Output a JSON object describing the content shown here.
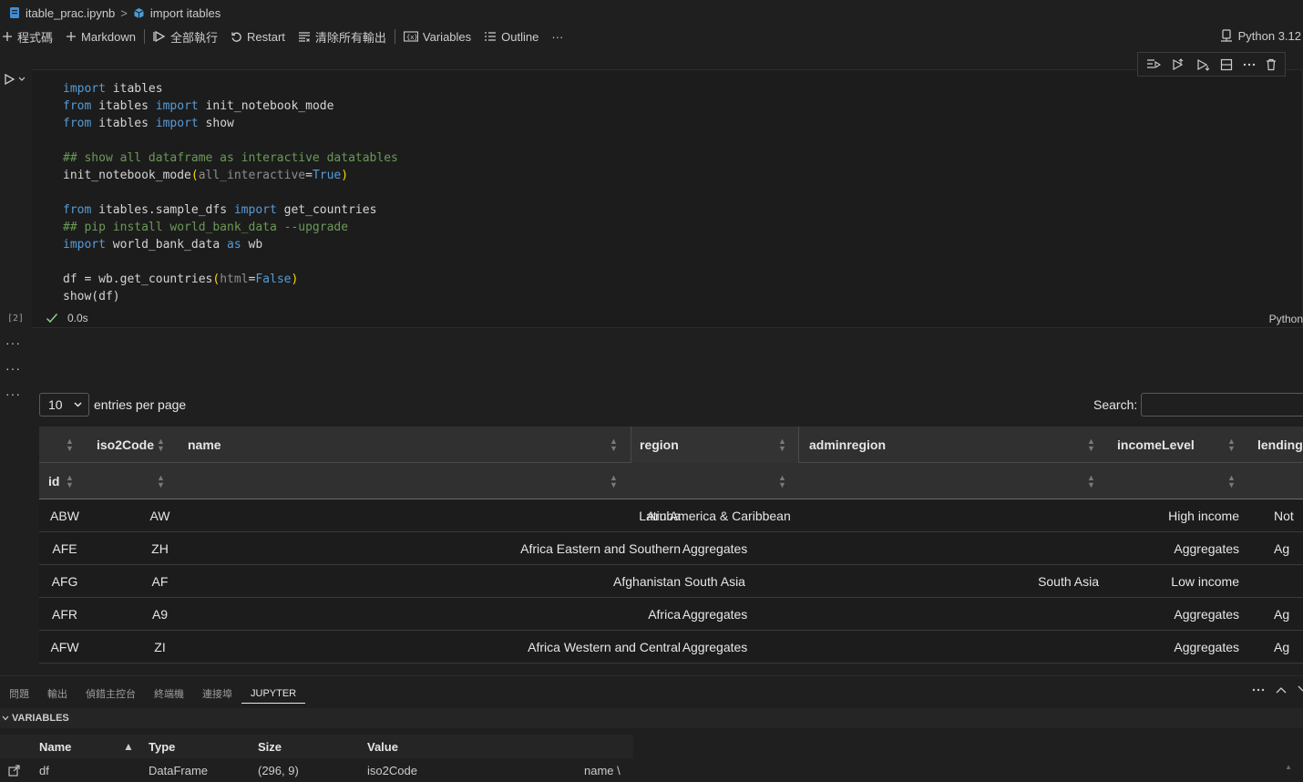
{
  "breadcrumb": {
    "file": "itable_prac.ipynb",
    "separator": ">",
    "section": "import itables"
  },
  "toolbar": {
    "code": "程式碼",
    "markdown": "Markdown",
    "run_all": "全部執行",
    "restart": "Restart",
    "clear_outputs": "清除所有輸出",
    "variables": "Variables",
    "outline": "Outline",
    "more": "···",
    "kernel": "Python 3.12"
  },
  "cell": {
    "code_lines": [
      "import itables",
      "from itables import init_notebook_mode",
      "from itables import show",
      "",
      "## show all dataframe as interactive datatables",
      "init_notebook_mode(all_interactive=True)",
      "",
      "from itables.sample_dfs import get_countries",
      "## pip install world_bank_data --upgrade",
      "import world_bank_data as wb",
      "",
      "df = wb.get_countries(html=False)",
      "show(df)"
    ],
    "exec_count": "[2]",
    "exec_time": "0.0s",
    "language": "Python"
  },
  "output_dots": "···",
  "datatable": {
    "length_value": "10",
    "length_label": "entries per page",
    "search_label": "Search:",
    "header_row1": [
      "iso2Code",
      "name",
      "region",
      "adminregion",
      "incomeLevel",
      "lending"
    ],
    "header_row2": [
      "id"
    ],
    "rows": [
      [
        "ABW",
        "AW",
        "Aruba",
        "Latin America & Caribbean",
        "",
        "High income",
        "Not"
      ],
      [
        "AFE",
        "ZH",
        "Africa Eastern and Southern",
        "Aggregates",
        "",
        "Aggregates",
        "Ag"
      ],
      [
        "AFG",
        "AF",
        "Afghanistan",
        "South Asia",
        "South Asia",
        "Low income",
        ""
      ],
      [
        "AFR",
        "A9",
        "Africa",
        "Aggregates",
        "",
        "Aggregates",
        "Ag"
      ],
      [
        "AFW",
        "ZI",
        "Africa Western and Central",
        "Aggregates",
        "",
        "Aggregates",
        "Ag"
      ]
    ]
  },
  "panel": {
    "tabs": [
      "問題",
      "輸出",
      "偵錯主控台",
      "終端機",
      "連接埠",
      "JUPYTER"
    ],
    "section": "VARIABLES",
    "columns": [
      "Name",
      "Type",
      "Size",
      "Value"
    ],
    "sort_indicator": "▲",
    "variables": [
      {
        "name": "df",
        "type": "DataFrame",
        "size": "(296, 9)",
        "value": "iso2Code",
        "value_tail": "name \\"
      }
    ]
  }
}
